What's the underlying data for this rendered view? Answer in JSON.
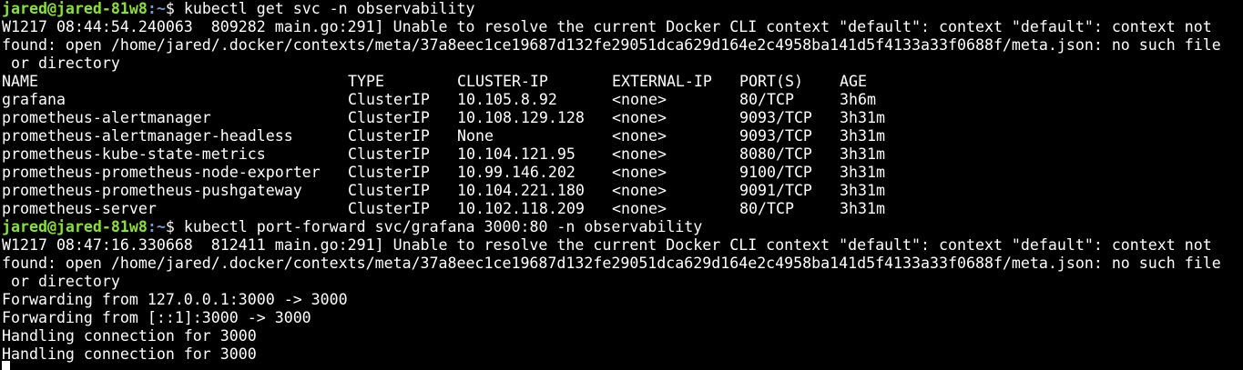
{
  "prompt": {
    "user_host": "jared@jared-81w8",
    "path": ":~",
    "symbol": "$"
  },
  "commands": {
    "get_svc": " kubectl get svc -n observability",
    "port_forward": " kubectl port-forward svc/grafana 3000:80 -n observability"
  },
  "warnings": {
    "first": [
      "W1217 08:44:54.240063  809282 main.go:291] Unable to resolve the current Docker CLI context \"default\": context \"default\": context not",
      "found: open /home/jared/.docker/contexts/meta/37a8eec1ce19687d132fe29051dca629d164e2c4958ba141d5f4133a33f0688f/meta.json: no such file",
      " or directory"
    ],
    "second": [
      "W1217 08:47:16.330668  812411 main.go:291] Unable to resolve the current Docker CLI context \"default\": context \"default\": context not",
      "found: open /home/jared/.docker/contexts/meta/37a8eec1ce19687d132fe29051dca629d164e2c4958ba141d5f4133a33f0688f/meta.json: no such file",
      " or directory"
    ]
  },
  "services_table": {
    "headers": [
      "NAME",
      "TYPE",
      "CLUSTER-IP",
      "EXTERNAL-IP",
      "PORT(S)",
      "AGE"
    ],
    "rows": [
      [
        "grafana",
        "ClusterIP",
        "10.105.8.92",
        "<none>",
        "80/TCP",
        "3h6m"
      ],
      [
        "prometheus-alertmanager",
        "ClusterIP",
        "10.108.129.128",
        "<none>",
        "9093/TCP",
        "3h31m"
      ],
      [
        "prometheus-alertmanager-headless",
        "ClusterIP",
        "None",
        "<none>",
        "9093/TCP",
        "3h31m"
      ],
      [
        "prometheus-kube-state-metrics",
        "ClusterIP",
        "10.104.121.95",
        "<none>",
        "8080/TCP",
        "3h31m"
      ],
      [
        "prometheus-prometheus-node-exporter",
        "ClusterIP",
        "10.99.146.202",
        "<none>",
        "9100/TCP",
        "3h31m"
      ],
      [
        "prometheus-prometheus-pushgateway",
        "ClusterIP",
        "10.104.221.180",
        "<none>",
        "9091/TCP",
        "3h31m"
      ],
      [
        "prometheus-server",
        "ClusterIP",
        "10.102.118.209",
        "<none>",
        "80/TCP",
        "3h31m"
      ]
    ]
  },
  "forward_output": [
    "Forwarding from 127.0.0.1:3000 -> 3000",
    "Forwarding from [::1]:3000 -> 3000",
    "Handling connection for 3000",
    "Handling connection for 3000"
  ],
  "colors": {
    "background": "#000000",
    "foreground": "#ffffff",
    "prompt_user": "#8ae234",
    "prompt_path": "#729fcf"
  }
}
